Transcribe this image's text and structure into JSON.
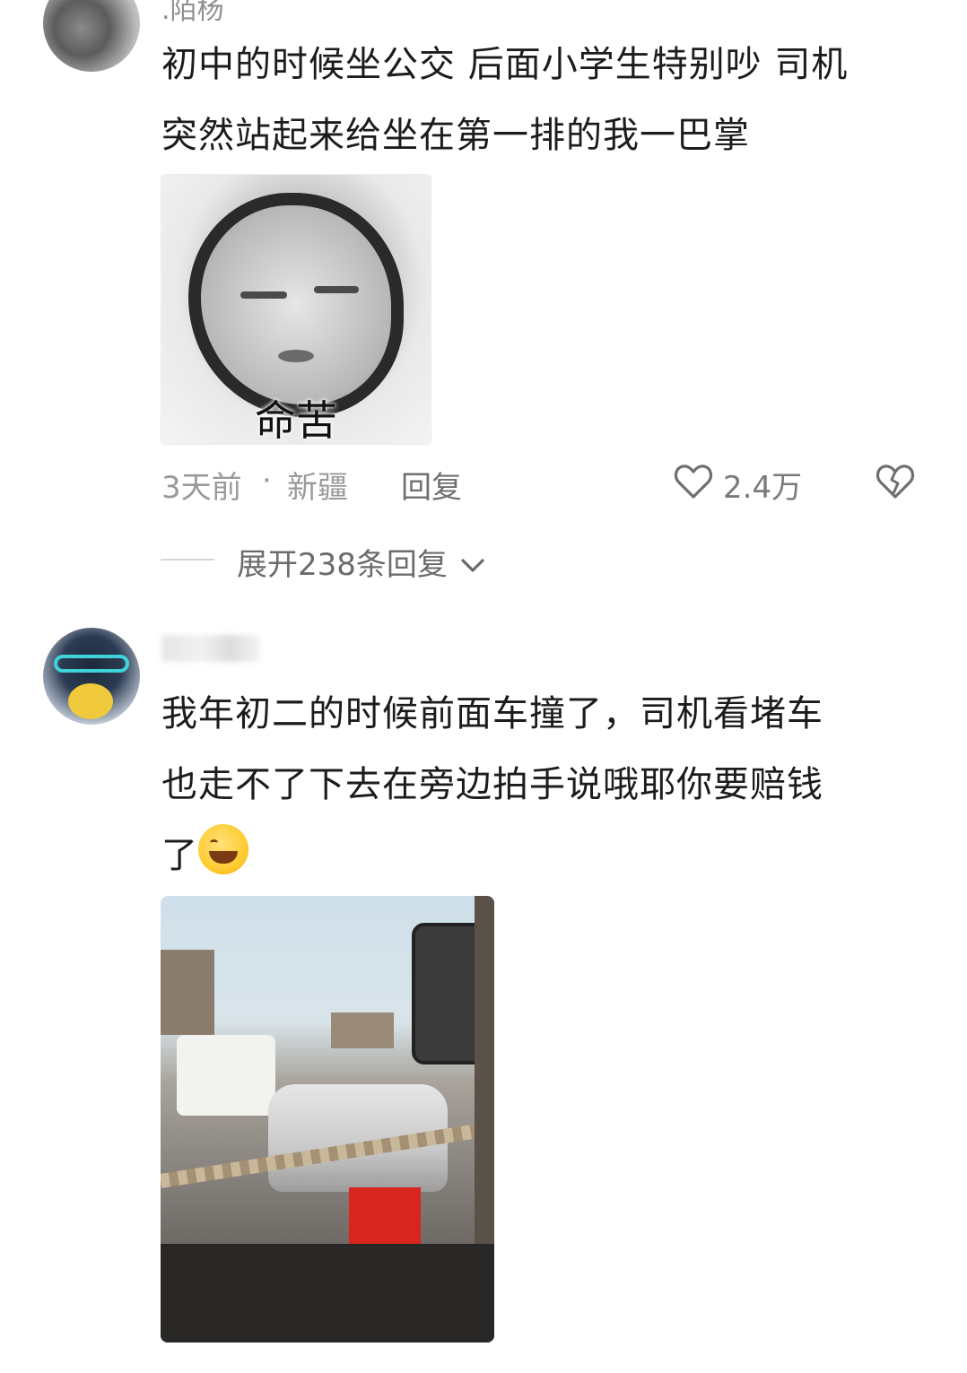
{
  "comments": [
    {
      "username": ".陌杨",
      "text_lines": [
        "初中的时候坐公交 后面小学生特别吵 司机",
        "突然站起来给坐在第一排的我一巴掌"
      ],
      "sticker_caption": "命苦",
      "time": "3天前",
      "separator": "·",
      "location": "新疆",
      "reply_label": "回复",
      "likes": "2.4万",
      "expand_label": "展开238条回复"
    },
    {
      "username": "",
      "text_lines": [
        "我年初二的时候前面车撞了，司机看堵车",
        "也走不了下去在旁边拍手说哦耶你要赔钱",
        "了"
      ],
      "emoji": "grinning-face-emoji"
    }
  ],
  "icons": {
    "like": "heart-outline-icon",
    "dislike": "broken-heart-icon",
    "expand": "chevron-down-icon"
  },
  "colors": {
    "text": "#1c1c1c",
    "meta": "#9a9a9a",
    "background": "#ffffff"
  }
}
